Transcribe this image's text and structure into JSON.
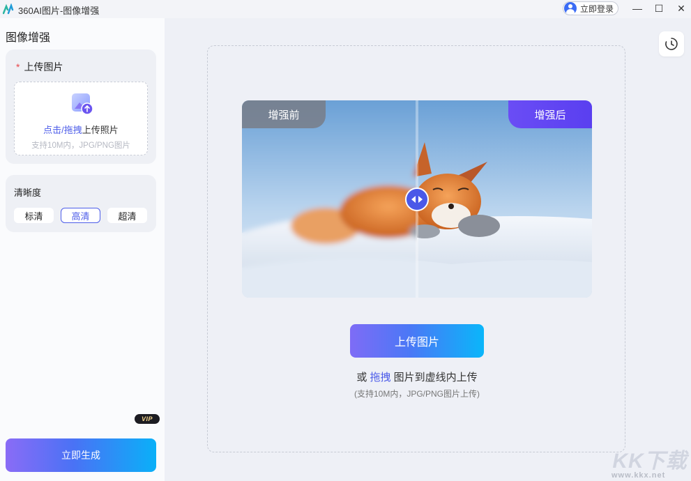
{
  "window": {
    "title": "360AI图片-图像增强",
    "login_label": "立即登录",
    "min_glyph": "—",
    "max_glyph": "☐",
    "close_glyph": "✕"
  },
  "sidebar": {
    "title": "图像增强",
    "upload": {
      "required_mark": "*",
      "label": "上传图片",
      "drop_link": "点击/拖拽",
      "drop_text": "上传照片",
      "drop_sub": "支持10M内，JPG/PNG图片"
    },
    "clarity": {
      "title": "清晰度",
      "options": [
        "标清",
        "高清",
        "超清"
      ],
      "selected": "高清"
    },
    "generate_label": "立即生成",
    "vip_label": "VIP"
  },
  "main": {
    "before_label": "增强前",
    "after_label": "增强后",
    "upload_button": "上传图片",
    "hint_prefix": "或 ",
    "hint_link": "拖拽",
    "hint_suffix": " 图片到虚线内上传",
    "hint_sub": "(支持10M内，JPG/PNG图片上传)"
  },
  "watermark": {
    "text": "KK下载",
    "url": "www.kkx.net"
  },
  "icons": [
    "app-logo-icon",
    "user-avatar-icon",
    "upload-image-icon",
    "history-clock-icon",
    "slider-arrows-icon"
  ],
  "colors": {
    "accent": "#4d5de9",
    "gradient_start": "#7e6cf6",
    "gradient_end": "#0ab6fa",
    "required": "#e8464a"
  }
}
